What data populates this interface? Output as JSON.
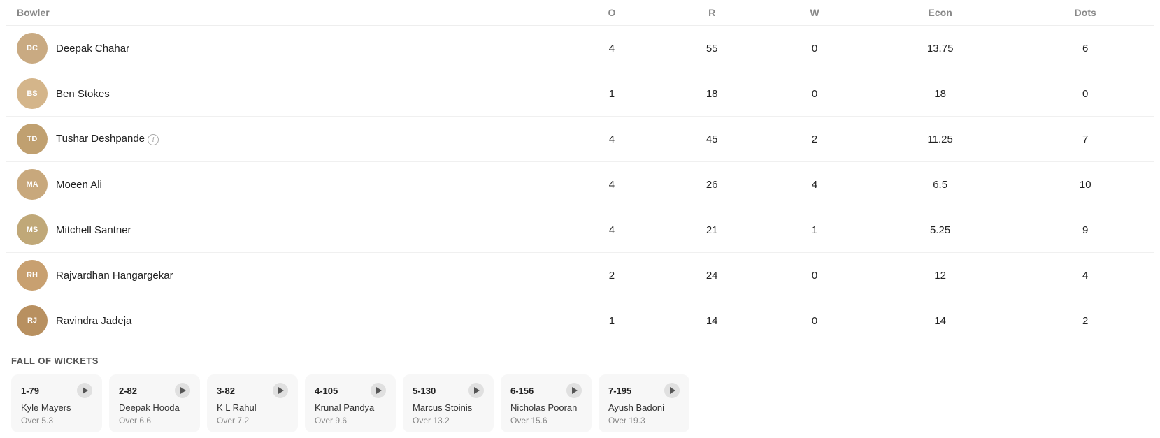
{
  "table": {
    "header": {
      "bowler": "Bowler",
      "o": "O",
      "r": "R",
      "w": "W",
      "econ": "Econ",
      "dots": "Dots"
    },
    "rows": [
      {
        "name": "Deepak Chahar",
        "avatar_initials": "DC",
        "avatar_color": "#c8a97e",
        "has_info": false,
        "o": "4",
        "r": "55",
        "w": "0",
        "econ": "13.75",
        "dots": "6"
      },
      {
        "name": "Ben Stokes",
        "avatar_initials": "BS",
        "avatar_color": "#d4b896",
        "has_info": false,
        "o": "1",
        "r": "18",
        "w": "0",
        "econ": "18",
        "dots": "0"
      },
      {
        "name": "Tushar Deshpande",
        "avatar_initials": "TD",
        "avatar_color": "#c8a97e",
        "has_info": true,
        "o": "4",
        "r": "45",
        "w": "2",
        "econ": "11.25",
        "dots": "7"
      },
      {
        "name": "Moeen Ali",
        "avatar_initials": "MA",
        "avatar_color": "#c8a97e",
        "has_info": false,
        "o": "4",
        "r": "26",
        "w": "4",
        "econ": "6.5",
        "dots": "10"
      },
      {
        "name": "Mitchell Santner",
        "avatar_initials": "MS",
        "avatar_color": "#d4b896",
        "has_info": false,
        "o": "4",
        "r": "21",
        "w": "1",
        "econ": "5.25",
        "dots": "9"
      },
      {
        "name": "Rajvardhan Hangargekar",
        "avatar_initials": "RH",
        "avatar_color": "#c8a97e",
        "has_info": false,
        "o": "2",
        "r": "24",
        "w": "0",
        "econ": "12",
        "dots": "4"
      },
      {
        "name": "Ravindra Jadeja",
        "avatar_initials": "RJ",
        "avatar_color": "#c8a97e",
        "has_info": false,
        "o": "1",
        "r": "14",
        "w": "0",
        "econ": "14",
        "dots": "2"
      }
    ]
  },
  "fow": {
    "title": "FALL OF WICKETS",
    "cards": [
      {
        "score": "1-79",
        "player": "Kyle Mayers",
        "over": "Over 5.3"
      },
      {
        "score": "2-82",
        "player": "Deepak Hooda",
        "over": "Over 6.6"
      },
      {
        "score": "3-82",
        "player": "K L Rahul",
        "over": "Over 7.2"
      },
      {
        "score": "4-105",
        "player": "Krunal Pandya",
        "over": "Over 9.6"
      },
      {
        "score": "5-130",
        "player": "Marcus Stoinis",
        "over": "Over 13.2"
      },
      {
        "score": "6-156",
        "player": "Nicholas Pooran",
        "over": "Over 15.6"
      },
      {
        "score": "7-195",
        "player": "Ayush Badoni",
        "over": "Over 19.3"
      }
    ]
  }
}
